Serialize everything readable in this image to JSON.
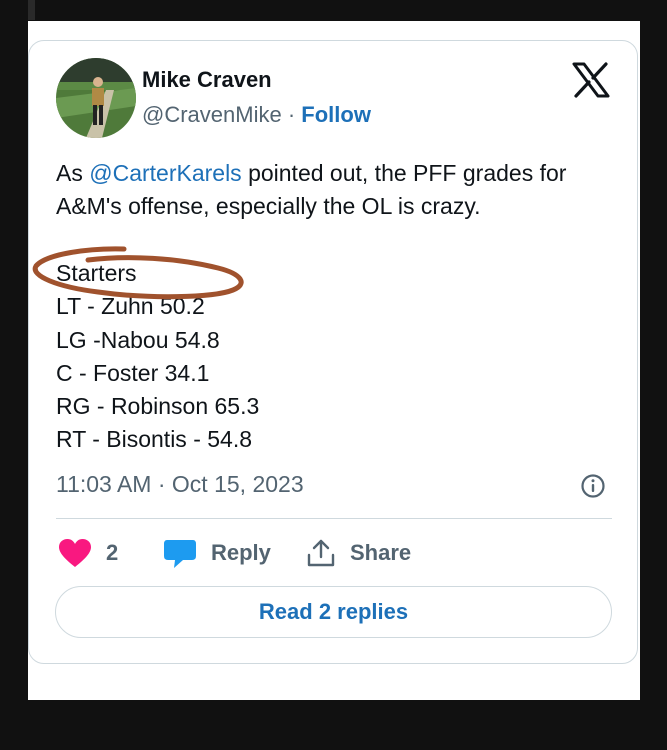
{
  "tweet": {
    "author": {
      "name": "Mike Craven",
      "handle": "@CravenMike",
      "separator": "·",
      "follow_label": "Follow"
    },
    "text": {
      "before_mention": "As ",
      "mention": "@CarterKarels",
      "after_mention": " pointed out, the PFF grades for A&M's offense, especially the OL is crazy."
    },
    "starters_heading": "Starters",
    "lines": [
      "LT - Zuhn 50.2",
      "LG -Nabou 54.8",
      "C - Foster 34.1",
      "RG - Robinson 65.3",
      "RT - Bisontis - 54.8"
    ],
    "timestamp": "11:03 AM · Oct 15, 2023"
  },
  "actions": {
    "like_count": "2",
    "reply_label": "Reply",
    "share_label": "Share",
    "read_replies_label": "Read 2 replies"
  },
  "icons": {
    "logo": "x-logo-icon",
    "info": "info-icon",
    "like": "heart-icon",
    "reply": "speech-bubble-icon",
    "share": "share-icon"
  },
  "colors": {
    "link": "#1d70b8",
    "heart": "#f91880",
    "reply_bubble": "#1d9bf0",
    "annotation": "#a0522d"
  }
}
